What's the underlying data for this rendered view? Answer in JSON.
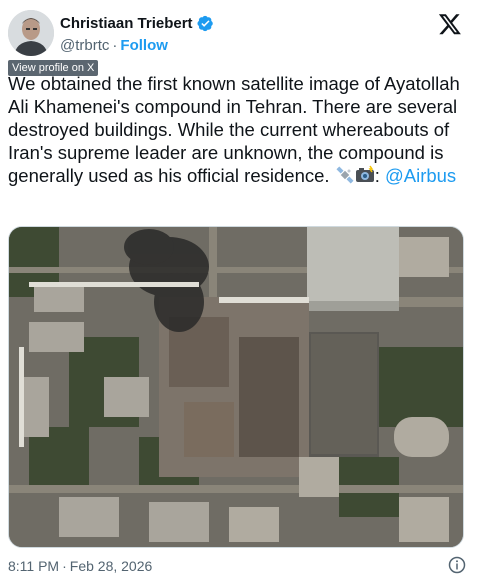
{
  "author": {
    "name": "Christiaan Triebert",
    "handle": "@trbrtc",
    "follow_label": "Follow",
    "separator": "·"
  },
  "tooltip": "View profile on X",
  "tweet": {
    "text": "We obtained the first known satellite image of Ayatollah Ali Khamenei's compound in Tehran. There are several destroyed buildings. While the current whereabouts of Iran's supreme leader are unknown, the compound is generally used as his official residence. ",
    "emoji_sep": ": ",
    "mention": "@Airbus"
  },
  "footer": {
    "time": "8:11 PM",
    "separator": "·",
    "date": "Feb 28, 2026"
  },
  "colors": {
    "accent": "#1d9bf0",
    "secondary_text": "#536471",
    "tooltip_bg": "#5b6670"
  },
  "icons": {
    "verified": "verified-badge-icon",
    "logo": "x-logo-icon",
    "satellite": "satellite-emoji-icon",
    "camera": "camera-flash-emoji-icon",
    "info": "info-icon"
  }
}
